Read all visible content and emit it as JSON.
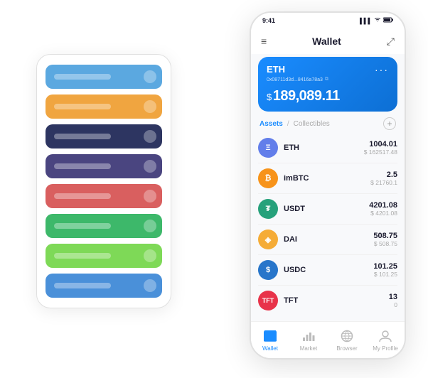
{
  "scene": {
    "card_stack": {
      "cards": [
        {
          "color": "#5ba8e0",
          "label": "card-1"
        },
        {
          "color": "#f0a540",
          "label": "card-2"
        },
        {
          "color": "#2d3561",
          "label": "card-3"
        },
        {
          "color": "#4a4580",
          "label": "card-4"
        },
        {
          "color": "#d95f5f",
          "label": "card-5"
        },
        {
          "color": "#3db86a",
          "label": "card-6"
        },
        {
          "color": "#7ed957",
          "label": "card-7"
        },
        {
          "color": "#4a90d9",
          "label": "card-8"
        }
      ]
    },
    "phone": {
      "status_bar": {
        "time": "9:41",
        "signal": "▌▌▌",
        "wifi": "WiFi",
        "battery": "Battery"
      },
      "nav": {
        "menu_icon": "≡",
        "title": "Wallet",
        "expand_icon": "⤢"
      },
      "eth_card": {
        "label": "ETH",
        "address": "0x08711d3d...8416a78a3",
        "copy_icon": "⧉",
        "dots": "···",
        "balance_prefix": "$",
        "balance": "189,089.11"
      },
      "assets_header": {
        "tab_active": "Assets",
        "divider": "/",
        "tab_inactive": "Collectibles",
        "add_icon": "+"
      },
      "assets": [
        {
          "symbol": "ETH",
          "icon_type": "eth",
          "icon_text": "Ξ",
          "amount": "1004.01",
          "usd": "$ 162517.48"
        },
        {
          "symbol": "imBTC",
          "icon_type": "imbtc",
          "icon_text": "₿",
          "amount": "2.5",
          "usd": "$ 21760.1"
        },
        {
          "symbol": "USDT",
          "icon_type": "usdt",
          "icon_text": "₮",
          "amount": "4201.08",
          "usd": "$ 4201.08"
        },
        {
          "symbol": "DAI",
          "icon_type": "dai",
          "icon_text": "◈",
          "amount": "508.75",
          "usd": "$ 508.75"
        },
        {
          "symbol": "USDC",
          "icon_type": "usdc",
          "icon_text": "$",
          "amount": "101.25",
          "usd": "$ 101.25"
        },
        {
          "symbol": "TFT",
          "icon_type": "tft",
          "icon_text": "T",
          "amount": "13",
          "usd": "0"
        }
      ],
      "bottom_nav": [
        {
          "id": "wallet",
          "label": "Wallet",
          "active": true
        },
        {
          "id": "market",
          "label": "Market",
          "active": false
        },
        {
          "id": "browser",
          "label": "Browser",
          "active": false
        },
        {
          "id": "profile",
          "label": "My Profile",
          "active": false
        }
      ]
    }
  }
}
